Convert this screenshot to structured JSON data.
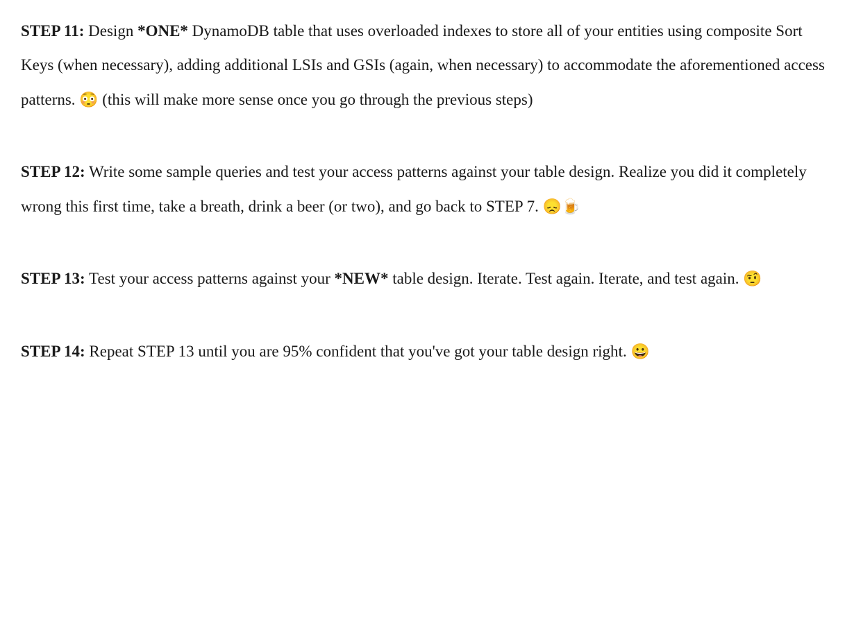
{
  "steps": [
    {
      "label": "STEP 11:",
      "segments": [
        {
          "text": " Design "
        },
        {
          "text": "*ONE*",
          "bold": true
        },
        {
          "text": " DynamoDB table that uses overloaded indexes to store all of your entities using composite Sort Keys (when necessary), adding additional LSIs and GSIs (again, when necessary) to accommodate the aforementioned access patterns. "
        },
        {
          "text": "😳",
          "emoji": true
        },
        {
          "text": " (this will make more sense once you go through the previous steps)"
        }
      ]
    },
    {
      "label": "STEP 12:",
      "segments": [
        {
          "text": " Write some sample queries and test your access patterns against your table design. Realize you did it completely wrong this first time, take a breath, drink a beer (or two), and go back to STEP 7. "
        },
        {
          "text": "😞",
          "emoji": true
        },
        {
          "text": "🍺",
          "emoji": true
        }
      ]
    },
    {
      "label": "STEP 13:",
      "segments": [
        {
          "text": " Test your access patterns against your "
        },
        {
          "text": "*NEW*",
          "bold": true
        },
        {
          "text": " table design. Iterate. Test again. Iterate, and test again. "
        },
        {
          "text": "🤨",
          "emoji": true
        }
      ]
    },
    {
      "label": "STEP 14:",
      "segments": [
        {
          "text": " Repeat STEP 13 until you are 95% confident that you've got your table design right. "
        },
        {
          "text": "😀",
          "emoji": true
        }
      ]
    }
  ]
}
